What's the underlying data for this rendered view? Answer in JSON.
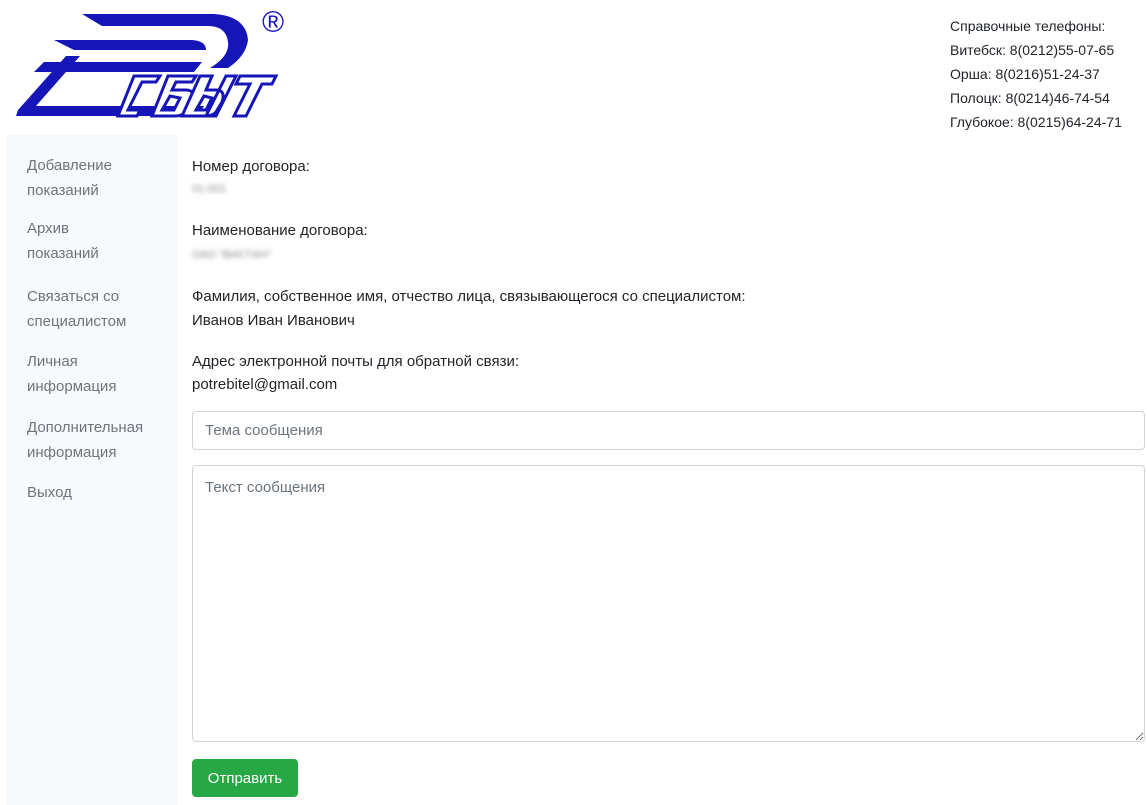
{
  "logo": {
    "text": "ЭСБЫТ",
    "registered_mark": "®",
    "brand_color": "#1515b8"
  },
  "phones": {
    "title": "Справочные телефоны:",
    "lines": [
      "Витебск: 8(0212)55-07-65",
      "Орша: 8(0216)51-24-37",
      "Полоцк: 8(0214)46-74-54",
      "Глубокое: 8(0215)64-24-71"
    ]
  },
  "sidebar": {
    "items": [
      {
        "line1": "Добавление",
        "line2": "показаний"
      },
      {
        "line1": "Архив",
        "line2": "показаний"
      },
      {
        "line1": "Связаться со",
        "line2": "специалистом"
      },
      {
        "line1": "Личная",
        "line2": "информация"
      },
      {
        "line1": "Дополнительная",
        "line2": "информация"
      },
      {
        "line1": "Выход",
        "line2": ""
      }
    ]
  },
  "form": {
    "contract_number_label": "Номер договора:",
    "contract_number_value": "01-001",
    "contract_name_label": "Наименование договора:",
    "contract_name_value": "ОАО \"ВИСТАН\"",
    "person_label": "Фамилия, собственное имя, отчество лица, связывающегося со специалистом:",
    "person_value": "Иванов Иван Иванович",
    "email_label": "Адрес электронной почты для обратной связи:",
    "email_value": "potrebitel@gmail.com",
    "subject_placeholder": "Тема сообщения",
    "message_placeholder": "Текст сообщения",
    "send_label": "Отправить"
  },
  "colors": {
    "sidebar_bg": "#f8f9fa",
    "sidebar_text": "#6c757d",
    "button_green": "#28a745"
  }
}
